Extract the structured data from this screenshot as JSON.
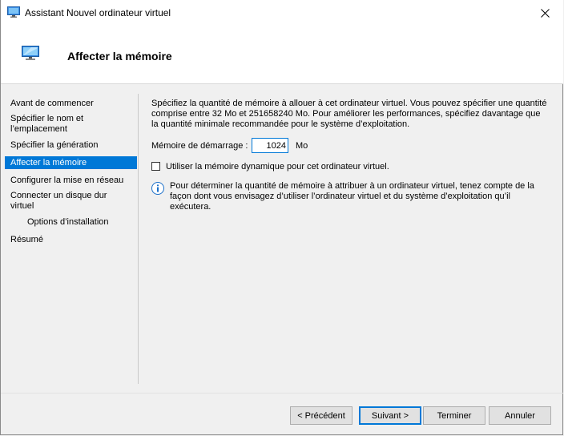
{
  "window": {
    "title": "Assistant Nouvel ordinateur virtuel",
    "close_glyph": "✕"
  },
  "header": {
    "title": "Affecter la mémoire",
    "icon": "virtual-machine-icon"
  },
  "nav": {
    "items": [
      {
        "label": "Avant de commencer",
        "selected": false
      },
      {
        "label": "Spécifier le nom et l’emplacement",
        "selected": false
      },
      {
        "label": "Spécifier la génération",
        "selected": false
      },
      {
        "label": "Affecter la mémoire",
        "selected": true
      },
      {
        "label": "Configurer la mise en réseau",
        "selected": false
      },
      {
        "label": "Connecter un disque dur virtuel",
        "selected": false
      },
      {
        "label": "Options d’installation",
        "selected": false
      },
      {
        "label": "Résumé",
        "selected": false
      }
    ]
  },
  "content": {
    "intro": "Spécifiez la quantité de mémoire à allouer à cet ordinateur virtuel. Vous pouvez spécifier une quantité comprise entre 32 Mo et 251658240 Mo. Pour améliorer les performances, spécifiez davantage que la quantité minimale recommandée pour le système d’exploitation.",
    "startup_memory": {
      "label": "Mémoire de démarrage :",
      "value": "1024",
      "unit": "Mo"
    },
    "dynamic_memory": {
      "label": "Utiliser la mémoire dynamique pour cet ordinateur virtuel.",
      "checked": false
    },
    "info": "Pour déterminer la quantité de mémoire à attribuer à un ordinateur virtuel, tenez compte de la façon dont vous envisagez d’utiliser l’ordinateur virtuel et du système d’exploitation qu’il exécutera."
  },
  "footer": {
    "previous_label": "< Précédent",
    "next_label": "Suivant >",
    "finish_label": "Terminer",
    "cancel_label": "Annuler"
  },
  "colors": {
    "accent": "#0078d7",
    "window_bg": "#f0f0f0",
    "header_bg": "#ffffff"
  }
}
